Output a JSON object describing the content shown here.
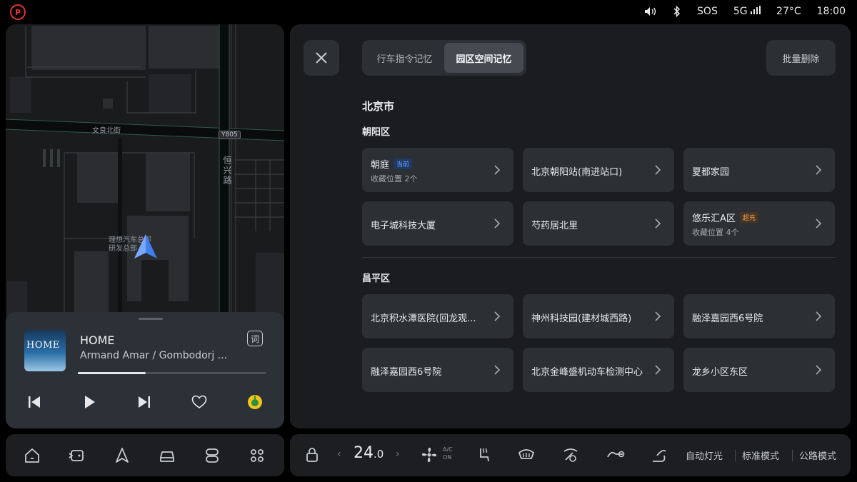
{
  "status": {
    "parking_icon": "P",
    "volume_icon": "volume-icon",
    "bluetooth_icon": "bluetooth-icon",
    "sos": "SOS",
    "network": "5G",
    "temperature": "27°C",
    "time": "18:00"
  },
  "map": {
    "road1": "文良北街",
    "road2": "恒兴路",
    "road_badge": "Y805",
    "poi": "理想汽车总部\n研发总部"
  },
  "media": {
    "album_text": "HOME",
    "title": "HOME",
    "artist": "Armand Amar / Gombodorj ...",
    "lyrics_label": "词",
    "progress": 0.36
  },
  "panel": {
    "tabs": [
      {
        "label": "行车指令记忆",
        "active": false
      },
      {
        "label": "园区空间记忆",
        "active": true
      }
    ],
    "batch_delete": "批量删除",
    "city": "北京市",
    "districts": [
      {
        "name": "朝阳区",
        "items": [
          {
            "name": "朝庭",
            "tag": "当前",
            "tag_color": "blue",
            "sub": "收藏位置 2个"
          },
          {
            "name": "北京朝阳站(南进站口)",
            "tag": "",
            "sub": ""
          },
          {
            "name": "夏都家园",
            "tag": "",
            "sub": ""
          },
          {
            "name": "电子城科技大厦",
            "tag": "",
            "sub": ""
          },
          {
            "name": "芍药居北里",
            "tag": "",
            "sub": ""
          },
          {
            "name": "悠乐汇A区",
            "tag": "超充",
            "tag_color": "orange",
            "sub": "收藏位置 4个"
          }
        ]
      },
      {
        "name": "昌平区",
        "items": [
          {
            "name": "北京积水潭医院(回龙观...",
            "tag": "",
            "sub": ""
          },
          {
            "name": "神州科技园(建材城西路)",
            "tag": "",
            "sub": ""
          },
          {
            "name": "融泽嘉园西6号院",
            "tag": "",
            "sub": ""
          },
          {
            "name": "融泽嘉园西6号院",
            "tag": "",
            "sub": ""
          },
          {
            "name": "北京金峰盛机动车检测中心",
            "tag": "",
            "sub": ""
          },
          {
            "name": "龙乡小区东区",
            "tag": "",
            "sub": ""
          }
        ]
      }
    ]
  },
  "climate": {
    "temp_main": "24",
    "temp_decimal": ".0",
    "ac_line1": "A/C",
    "ac_line2": "ON",
    "auto_light": "自动灯光",
    "mode1": "标准模式",
    "mode2": "公路模式"
  },
  "colors": {
    "accent_blue": "#4a8cff",
    "warning_red": "#e0342c",
    "tag_orange": "#e9a25d"
  }
}
